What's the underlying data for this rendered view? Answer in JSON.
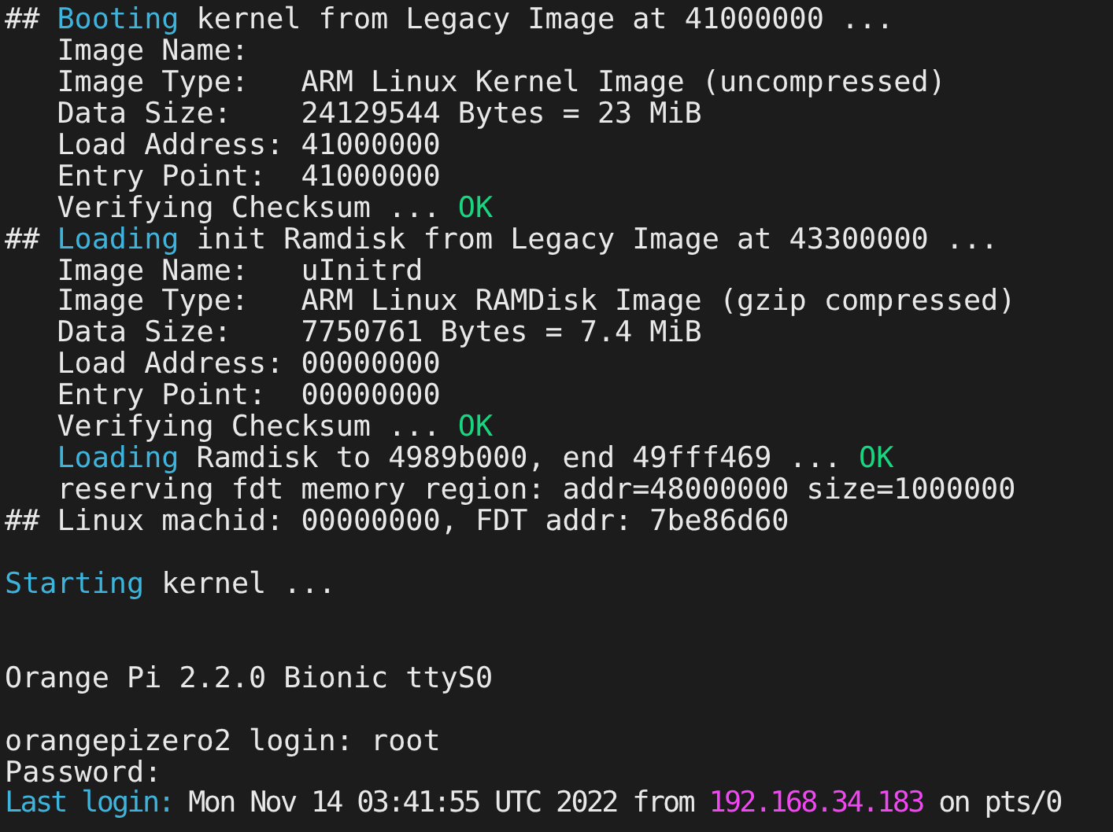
{
  "terminal": {
    "lines": [
      {
        "kind": "text",
        "indent": false,
        "segments": [
          {
            "text": "## ",
            "kind": "plain"
          },
          {
            "text": "Booting",
            "kind": "info"
          },
          {
            "text": " kernel from Legacy Image at 41000000 ...",
            "kind": "plain"
          }
        ]
      },
      {
        "kind": "text",
        "indent": true,
        "segments": [
          {
            "text": "Image Name:",
            "kind": "plain"
          }
        ]
      },
      {
        "kind": "text",
        "indent": true,
        "segments": [
          {
            "text": "Image Type:   ARM Linux Kernel Image (uncompressed)",
            "kind": "plain"
          }
        ]
      },
      {
        "kind": "text",
        "indent": true,
        "segments": [
          {
            "text": "Data Size:    24129544 Bytes = 23 MiB",
            "kind": "plain"
          }
        ]
      },
      {
        "kind": "text",
        "indent": true,
        "segments": [
          {
            "text": "Load Address: 41000000",
            "kind": "plain"
          }
        ]
      },
      {
        "kind": "text",
        "indent": true,
        "segments": [
          {
            "text": "Entry Point:  41000000",
            "kind": "plain"
          }
        ]
      },
      {
        "kind": "text",
        "indent": true,
        "segments": [
          {
            "text": "Verifying Checksum ... ",
            "kind": "plain"
          },
          {
            "text": "OK",
            "kind": "ok"
          }
        ]
      },
      {
        "kind": "text",
        "indent": false,
        "segments": [
          {
            "text": "## ",
            "kind": "plain"
          },
          {
            "text": "Loading",
            "kind": "info"
          },
          {
            "text": " init Ramdisk from Legacy Image at 43300000 ...",
            "kind": "plain"
          }
        ]
      },
      {
        "kind": "text",
        "indent": true,
        "segments": [
          {
            "text": "Image Name:   uInitrd",
            "kind": "plain"
          }
        ]
      },
      {
        "kind": "text",
        "indent": true,
        "segments": [
          {
            "text": "Image Type:   ARM Linux RAMDisk Image (gzip compressed)",
            "kind": "plain"
          }
        ]
      },
      {
        "kind": "text",
        "indent": true,
        "segments": [
          {
            "text": "Data Size:    7750761 Bytes = 7.4 MiB",
            "kind": "plain"
          }
        ]
      },
      {
        "kind": "text",
        "indent": true,
        "segments": [
          {
            "text": "Load Address: 00000000",
            "kind": "plain"
          }
        ]
      },
      {
        "kind": "text",
        "indent": true,
        "segments": [
          {
            "text": "Entry Point:  00000000",
            "kind": "plain"
          }
        ]
      },
      {
        "kind": "text",
        "indent": true,
        "segments": [
          {
            "text": "Verifying Checksum ... ",
            "kind": "plain"
          },
          {
            "text": "OK",
            "kind": "ok"
          }
        ]
      },
      {
        "kind": "text",
        "indent": true,
        "segments": [
          {
            "text": "Loading",
            "kind": "info"
          },
          {
            "text": " Ramdisk to 4989b000, end 49fff469 ... ",
            "kind": "plain"
          },
          {
            "text": "OK",
            "kind": "ok"
          }
        ]
      },
      {
        "kind": "text",
        "indent": true,
        "segments": [
          {
            "text": "reserving fdt memory region: addr=48000000 size=1000000",
            "kind": "plain"
          }
        ]
      },
      {
        "kind": "text",
        "indent": false,
        "segments": [
          {
            "text": "## Linux machid: 00000000, FDT addr: 7be86d60",
            "kind": "plain"
          }
        ]
      },
      {
        "kind": "blank"
      },
      {
        "kind": "text",
        "indent": false,
        "segments": [
          {
            "text": "Starting",
            "kind": "info"
          },
          {
            "text": " kernel ...",
            "kind": "plain"
          }
        ]
      },
      {
        "kind": "blank"
      },
      {
        "kind": "blank"
      },
      {
        "kind": "text",
        "indent": false,
        "segments": [
          {
            "text": "Orange Pi 2.2.0 Bionic ttyS0",
            "kind": "plain"
          }
        ]
      },
      {
        "kind": "blank"
      },
      {
        "kind": "text",
        "indent": false,
        "segments": [
          {
            "text": "orangepizero2 login: root",
            "kind": "plain"
          }
        ]
      },
      {
        "kind": "text",
        "indent": false,
        "segments": [
          {
            "text": "Password:",
            "kind": "plain"
          }
        ]
      },
      {
        "kind": "text",
        "indent": false,
        "segments": [
          {
            "text": "Last login:",
            "kind": "info"
          },
          {
            "text": " Mon Nov 14 03:41:55 UTC 2022 from ",
            "kind": "plain"
          },
          {
            "text": "192.168.34.183",
            "kind": "ip"
          },
          {
            "text": " on pts/0",
            "kind": "plain"
          }
        ]
      }
    ]
  }
}
